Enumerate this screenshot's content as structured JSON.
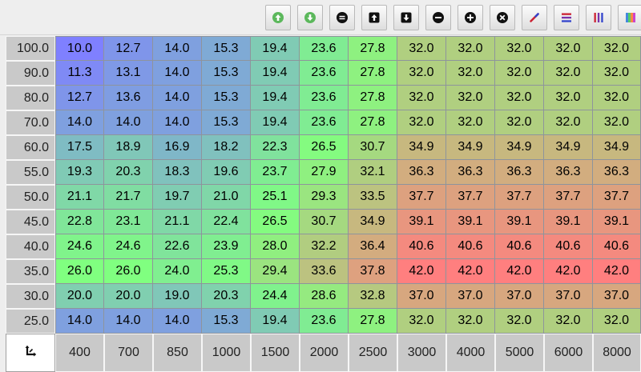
{
  "toolbar": {
    "buttons": [
      {
        "icon": "arrow-up-circle-green-icon",
        "color": "#5cb85c"
      },
      {
        "icon": "arrow-down-circle-green-icon",
        "color": "#5cb85c"
      },
      {
        "icon": "equals-circle-icon",
        "color": "#111111"
      },
      {
        "icon": "increment-arrow-up-icon",
        "color": "#111111"
      },
      {
        "icon": "decrement-arrow-down-icon",
        "color": "#111111"
      },
      {
        "icon": "minus-circle-icon",
        "color": "#111111"
      },
      {
        "icon": "plus-circle-icon",
        "color": "#111111"
      },
      {
        "icon": "multiply-circle-icon",
        "color": "#111111"
      },
      {
        "icon": "interpolate-line-icon",
        "color": "#cc2233"
      },
      {
        "icon": "horizontal-gradient-icon",
        "color": "#3344cc"
      },
      {
        "icon": "vertical-gradient-icon",
        "color": "#cc2233"
      },
      {
        "icon": "color-map-icon",
        "color": "#4488dd"
      }
    ]
  },
  "table": {
    "row_headers": [
      "100.0",
      "90.0",
      "80.0",
      "70.0",
      "60.0",
      "55.0",
      "50.0",
      "45.0",
      "40.0",
      "35.0",
      "30.0",
      "25.0"
    ],
    "col_headers": [
      "400",
      "700",
      "850",
      "1000",
      "1500",
      "2000",
      "2500",
      "3000",
      "4000",
      "5000",
      "6000",
      "8000"
    ],
    "rows": [
      [
        "10.0",
        "12.7",
        "14.0",
        "15.3",
        "19.4",
        "23.6",
        "27.8",
        "32.0",
        "32.0",
        "32.0",
        "32.0",
        "32.0"
      ],
      [
        "11.3",
        "13.1",
        "14.0",
        "15.3",
        "19.4",
        "23.6",
        "27.8",
        "32.0",
        "32.0",
        "32.0",
        "32.0",
        "32.0"
      ],
      [
        "12.7",
        "13.6",
        "14.0",
        "15.3",
        "19.4",
        "23.6",
        "27.8",
        "32.0",
        "32.0",
        "32.0",
        "32.0",
        "32.0"
      ],
      [
        "14.0",
        "14.0",
        "14.0",
        "15.3",
        "19.4",
        "23.6",
        "27.8",
        "32.0",
        "32.0",
        "32.0",
        "32.0",
        "32.0"
      ],
      [
        "17.5",
        "18.9",
        "16.9",
        "18.2",
        "22.3",
        "26.5",
        "30.7",
        "34.9",
        "34.9",
        "34.9",
        "34.9",
        "34.9"
      ],
      [
        "19.3",
        "20.3",
        "18.3",
        "19.6",
        "23.7",
        "27.9",
        "32.1",
        "36.3",
        "36.3",
        "36.3",
        "36.3",
        "36.3"
      ],
      [
        "21.1",
        "21.7",
        "19.7",
        "21.0",
        "25.1",
        "29.3",
        "33.5",
        "37.7",
        "37.7",
        "37.7",
        "37.7",
        "37.7"
      ],
      [
        "22.8",
        "23.1",
        "21.1",
        "22.4",
        "26.5",
        "30.7",
        "34.9",
        "39.1",
        "39.1",
        "39.1",
        "39.1",
        "39.1"
      ],
      [
        "24.6",
        "24.6",
        "22.6",
        "23.9",
        "28.0",
        "32.2",
        "36.4",
        "40.6",
        "40.6",
        "40.6",
        "40.6",
        "40.6"
      ],
      [
        "26.0",
        "26.0",
        "24.0",
        "25.3",
        "29.4",
        "33.6",
        "37.8",
        "42.0",
        "42.0",
        "42.0",
        "42.0",
        "42.0"
      ],
      [
        "20.0",
        "20.0",
        "19.0",
        "20.3",
        "24.4",
        "28.6",
        "32.8",
        "37.0",
        "37.0",
        "37.0",
        "37.0",
        "37.0"
      ],
      [
        "14.0",
        "14.0",
        "14.0",
        "15.3",
        "19.4",
        "23.6",
        "27.8",
        "32.0",
        "32.0",
        "32.0",
        "32.0",
        "32.0"
      ]
    ],
    "color_scale": {
      "min": 10.0,
      "max": 42.0,
      "low": "#7f80ff",
      "mid": "#80ff80",
      "high": "#ff7f7f"
    },
    "corner_icon": "swap-axes-icon"
  }
}
